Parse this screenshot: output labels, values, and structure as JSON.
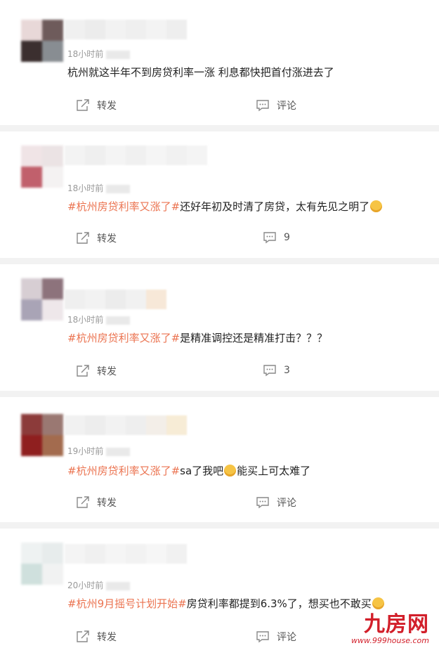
{
  "posts": [
    {
      "time": "18小时前",
      "text_tag": "",
      "text_body": "杭州就这半年不到房贷利率一涨 利息都快把首付涨进去了",
      "repost_label": "转发",
      "comment_label": "评论",
      "avatar_colors": [
        "#e8d8d8",
        "#6e5b5b",
        "#3b2f2f",
        "#888d92",
        "#f0f0f0",
        "#f3f3f3"
      ]
    },
    {
      "time": "18小时前",
      "text_tag": "#杭州房贷利率又涨了#",
      "text_body": "还好年初及时清了房贷，太有先见之明了",
      "repost_label": "转发",
      "comment_label": "9",
      "avatar_colors": [
        "#f0e4e6",
        "#ebe3e4",
        "#c1606c",
        "#f4f2f2",
        "#f5f5f5",
        "#f6f6f6"
      ]
    },
    {
      "time": "18小时前",
      "text_tag": "#杭州房贷利率又涨了#",
      "text_body": "是精准调控还是精准打击？？？",
      "repost_label": "转发",
      "comment_label": "3",
      "avatar_colors": [
        "#d7ced3",
        "#8d737c",
        "#a9a4b6",
        "#eee7ea",
        "#f2f2f4",
        "#f5f5f5"
      ]
    },
    {
      "time": "19小时前",
      "text_tag": "#杭州房贷利率又涨了#",
      "text_body_a": "sa了我吧",
      "text_body_b": "能买上可太难了",
      "repost_label": "转发",
      "comment_label": "评论",
      "avatar_colors": [
        "#8c3b3a",
        "#9a7872",
        "#8f1f1f",
        "#a36b4e",
        "#f3efee",
        "#f5f5f5"
      ]
    },
    {
      "time": "20小时前",
      "text_tag": "#杭州9月摇号计划开始#",
      "text_body": "房贷利率都提到6.3%了，想买也不敢买",
      "repost_label": "转发",
      "comment_label": "评论",
      "avatar_colors": [
        "#eef2f2",
        "#e7ecec",
        "#cfe0dd",
        "#f1f2f2",
        "#f6f6f6",
        "#f6f6f6"
      ]
    }
  ],
  "watermark": {
    "logo": "九房网",
    "url": "www.999house.com"
  }
}
